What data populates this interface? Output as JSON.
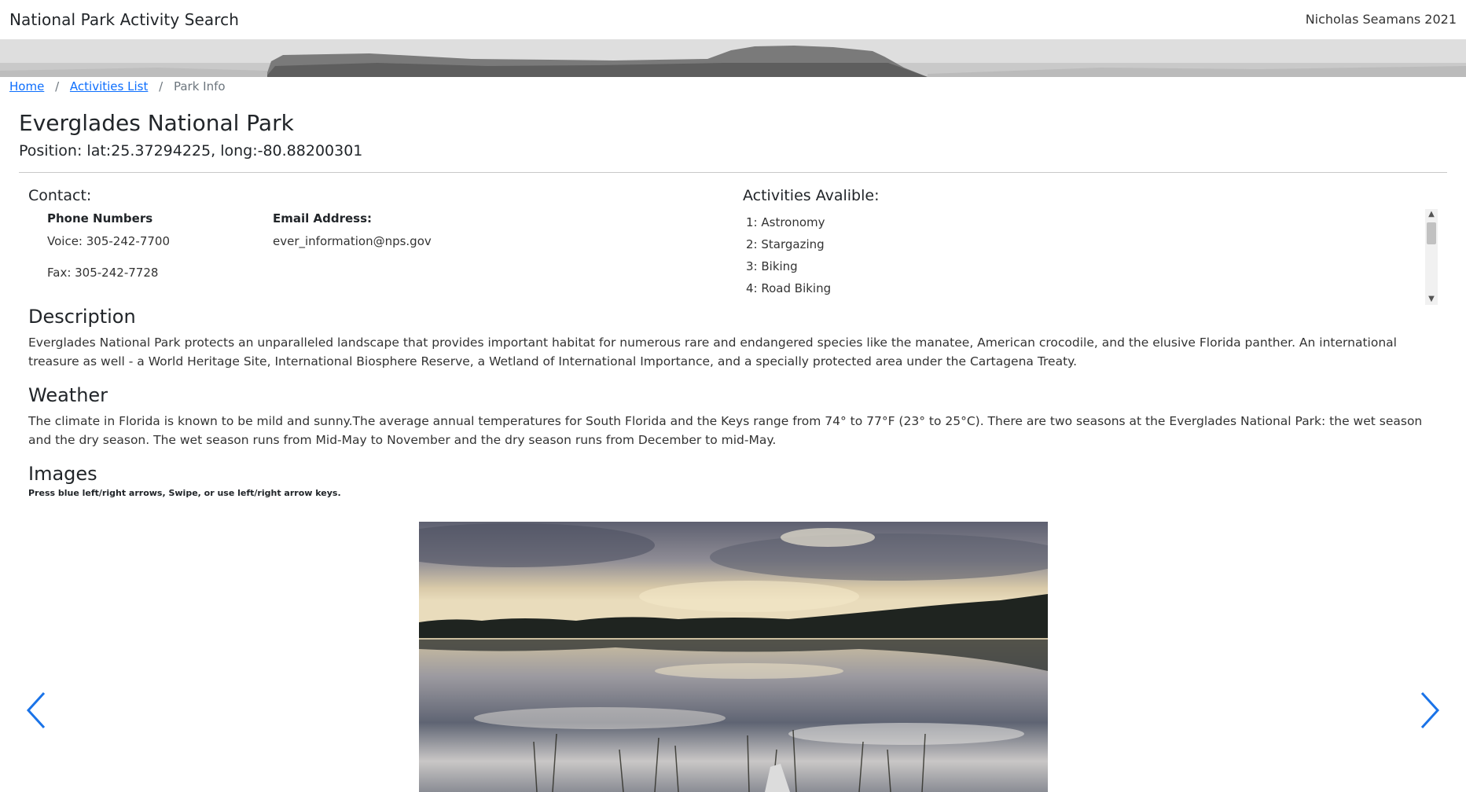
{
  "header": {
    "site_title": "National Park Activity Search",
    "author": "Nicholas Seamans 2021"
  },
  "breadcrumb": {
    "home": "Home",
    "activities": "Activities List",
    "current": "Park Info",
    "separator": "/"
  },
  "park": {
    "name": "Everglades National Park",
    "position": "Position: lat:25.37294225, long:-80.88200301"
  },
  "contact": {
    "heading": "Contact:",
    "phone_heading": "Phone Numbers",
    "voice": "Voice: 305-242-7700",
    "fax": "Fax: 305-242-7728",
    "email_heading": "Email Address:",
    "email": "ever_information@nps.gov"
  },
  "activities": {
    "heading": "Activities Avalible:",
    "items": [
      "1: Astronomy",
      "2: Stargazing",
      "3: Biking",
      "4: Road Biking"
    ]
  },
  "description": {
    "heading": "Description",
    "text": "Everglades National Park protects an unparalleled landscape that provides important habitat for numerous rare and endangered species like the manatee, American crocodile, and the elusive Florida panther. An international treasure as well - a World Heritage Site, International Biosphere Reserve, a Wetland of International Importance, and a specially protected area under the Cartagena Treaty."
  },
  "weather": {
    "heading": "Weather",
    "text": "The climate in Florida is known to be mild and sunny.The average annual temperatures for South Florida and the Keys range from 74° to 77°F (23° to 25°C). There are two seasons at the Everglades National Park: the wet season and the dry season. The wet season runs from Mid-May to November and the dry season runs from December to mid-May."
  },
  "images": {
    "heading": "Images",
    "hint": "Press blue left/right arrows, Swipe, or use left/right arrow keys."
  },
  "colors": {
    "link": "#0d6efd",
    "arrow": "#1a73e8",
    "text": "#212529"
  },
  "icons": {
    "prev": "chevron-left-icon",
    "next": "chevron-right-icon"
  }
}
